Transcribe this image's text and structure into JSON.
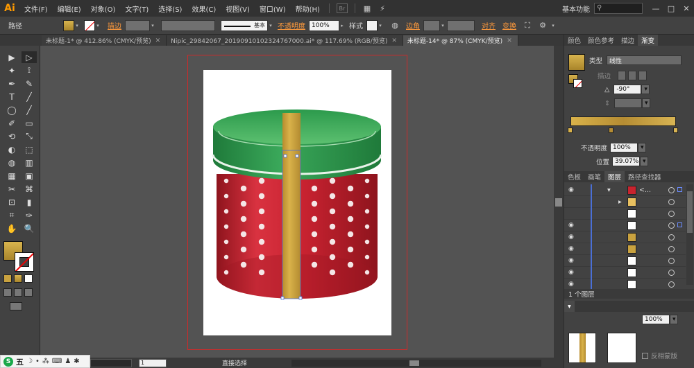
{
  "menubar": {
    "app_logo": "Ai",
    "items": [
      "文件(F)",
      "编辑(E)",
      "对象(O)",
      "文字(T)",
      "选择(S)",
      "效果(C)",
      "视图(V)",
      "窗口(W)",
      "帮助(H)"
    ],
    "badge": "Br",
    "workspace": "基本功能",
    "search_icon": "search-icon",
    "window_controls": [
      "—",
      "□",
      "✕"
    ]
  },
  "controlbar": {
    "mode_label": "路径",
    "fill_color": "#c9a23f",
    "stroke_label": "描边",
    "stroke_preset": "基本",
    "opacity_label": "不透明度",
    "opacity_value": "100%",
    "style_label": "样式",
    "corner_label": "边角",
    "align_label": "对齐",
    "transform_label": "变换"
  },
  "tabs": [
    {
      "label": "未标题-1* @ 412.86% (CMYK/预览)",
      "active": false
    },
    {
      "label": "Nipic_29842067_20190910102324767000.ai* @ 117.69% (RGB/预览)",
      "active": false
    },
    {
      "label": "未标题-14* @ 87% (CMYK/预览)",
      "active": true
    }
  ],
  "tab_close": "✕",
  "tools": [
    "▶",
    "▷",
    "✦",
    "⟟",
    "✒",
    "✎",
    "T",
    "╱",
    "◯",
    "╱",
    "✐",
    "▭",
    "⟲",
    "⤡",
    "◐",
    "⬚",
    "◍",
    "▥",
    "▦",
    "▣",
    "✂",
    "⌘",
    "⊡",
    "▮",
    "⌗",
    "✑",
    "✋",
    "🔍"
  ],
  "statusbar": {
    "zoom_value": "",
    "artboard_num": "1",
    "status_text": "直接选择"
  },
  "ime": {
    "logo": "S",
    "chars": [
      "五",
      "☽",
      "•",
      "⁂",
      "⌨",
      "♟",
      "✱"
    ]
  },
  "gradient_panel": {
    "tabs": [
      "颜色",
      "颜色参考",
      "描边",
      "渐变"
    ],
    "active_tab": "渐变",
    "type_label": "类型",
    "type_value": "线性",
    "stroke_label": "描边",
    "angle_value": "-90°",
    "opacity_label": "不透明度",
    "opacity_value": "100%",
    "position_label": "位置",
    "position_value": "39.07%",
    "stops": [
      {
        "position": 0,
        "color": "#d9b24a"
      },
      {
        "position": 39.07,
        "color": "#b58c33"
      },
      {
        "position": 100,
        "color": "#d8b453"
      }
    ]
  },
  "layers_panel": {
    "tabs": [
      "色板",
      "画笔",
      "图层",
      "路径查找器"
    ],
    "active_tab": "图层",
    "top_row_name": "<...",
    "rows": 9,
    "footer_text": "1 个图层"
  },
  "transparency_panel": {
    "opacity_value": "100%",
    "invert_mask_label": "反相蒙版"
  },
  "colors": {
    "lid_green": "#2f9a50",
    "box_red": "#c8232e",
    "ribbon_gold": "#c9a23f"
  }
}
